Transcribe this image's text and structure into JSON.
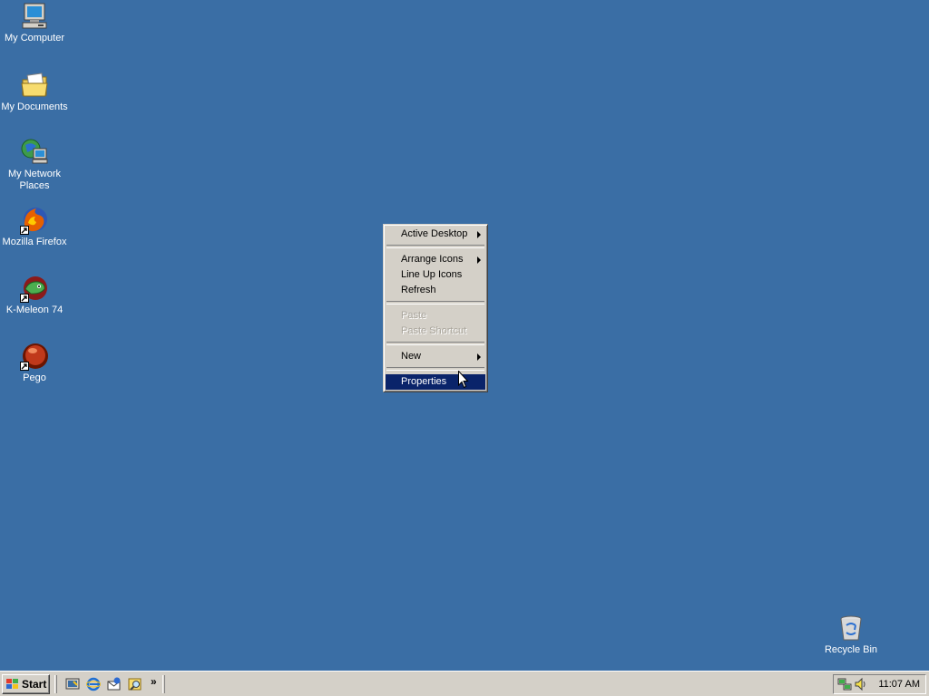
{
  "desktop": {
    "icons": [
      {
        "label": "My Computer",
        "icon": "my-computer-icon"
      },
      {
        "label": "My Documents",
        "icon": "my-documents-icon"
      },
      {
        "label": "My Network Places",
        "icon": "my-network-places-icon"
      },
      {
        "label": "Mozilla Firefox",
        "icon": "firefox-icon",
        "shortcut": true
      },
      {
        "label": "K-Meleon 74",
        "icon": "k-meleon-icon",
        "shortcut": true
      },
      {
        "label": "Pego",
        "icon": "pego-icon",
        "shortcut": true
      }
    ],
    "recycle_bin": {
      "label": "Recycle Bin",
      "icon": "recycle-bin-icon"
    },
    "background_color": "#3a6ea5"
  },
  "context_menu": {
    "items": [
      {
        "label": "Active Desktop",
        "submenu": true,
        "enabled": true
      },
      {
        "label": "Arrange Icons",
        "submenu": true,
        "enabled": true
      },
      {
        "label": "Line Up Icons",
        "submenu": false,
        "enabled": true
      },
      {
        "label": "Refresh",
        "submenu": false,
        "enabled": true
      },
      {
        "label": "Paste",
        "submenu": false,
        "enabled": false
      },
      {
        "label": "Paste Shortcut",
        "submenu": false,
        "enabled": false
      },
      {
        "label": "New",
        "submenu": true,
        "enabled": true
      },
      {
        "label": "Properties",
        "submenu": false,
        "enabled": true,
        "selected": true
      }
    ],
    "highlight_color": "#0a246a"
  },
  "taskbar": {
    "start_label": "Start",
    "quick_launch": [
      "show-desktop-icon",
      "internet-explorer-icon",
      "outlook-express-icon",
      "search-icon"
    ],
    "more_label": "»",
    "tray": {
      "icons": [
        "network-icon",
        "volume-icon"
      ],
      "clock": "11:07 AM"
    }
  }
}
